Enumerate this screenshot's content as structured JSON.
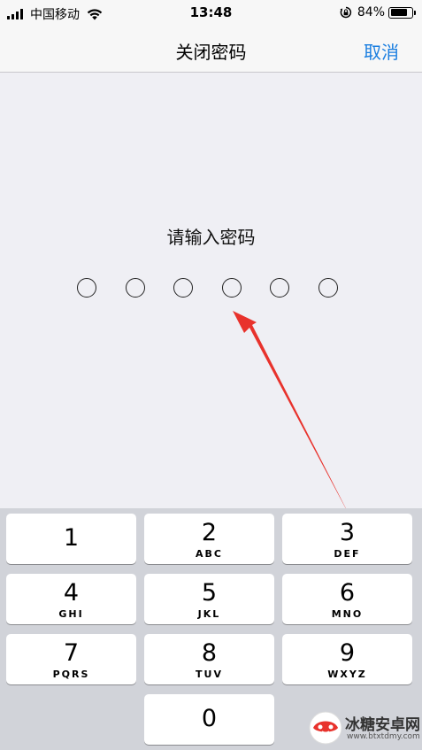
{
  "status_bar": {
    "carrier": "中国移动",
    "time": "13:48",
    "battery_percent": "84%",
    "battery_level": 0.84,
    "icons": [
      "signal-icon",
      "wifi-icon",
      "rotation-lock-icon",
      "battery-icon"
    ]
  },
  "nav": {
    "title": "关闭密码",
    "cancel_label": "取消"
  },
  "colors": {
    "accent": "#1a7ee0",
    "annotation_arrow": "#e8322c",
    "background": "#efeff4",
    "keypad_background": "#d1d3d9"
  },
  "passcode": {
    "prompt": "请输入密码",
    "length": 6,
    "entered": 0
  },
  "keypad": {
    "keys": [
      {
        "digit": "1",
        "letters": ""
      },
      {
        "digit": "2",
        "letters": "ABC"
      },
      {
        "digit": "3",
        "letters": "DEF"
      },
      {
        "digit": "4",
        "letters": "GHI"
      },
      {
        "digit": "5",
        "letters": "JKL"
      },
      {
        "digit": "6",
        "letters": "MNO"
      },
      {
        "digit": "7",
        "letters": "PQRS"
      },
      {
        "digit": "8",
        "letters": "TUV"
      },
      {
        "digit": "9",
        "letters": "WXYZ"
      },
      {
        "digit": "0",
        "letters": ""
      }
    ]
  },
  "watermark": {
    "name": "冰糖安卓网",
    "url": "www.btxtdmy.com"
  }
}
